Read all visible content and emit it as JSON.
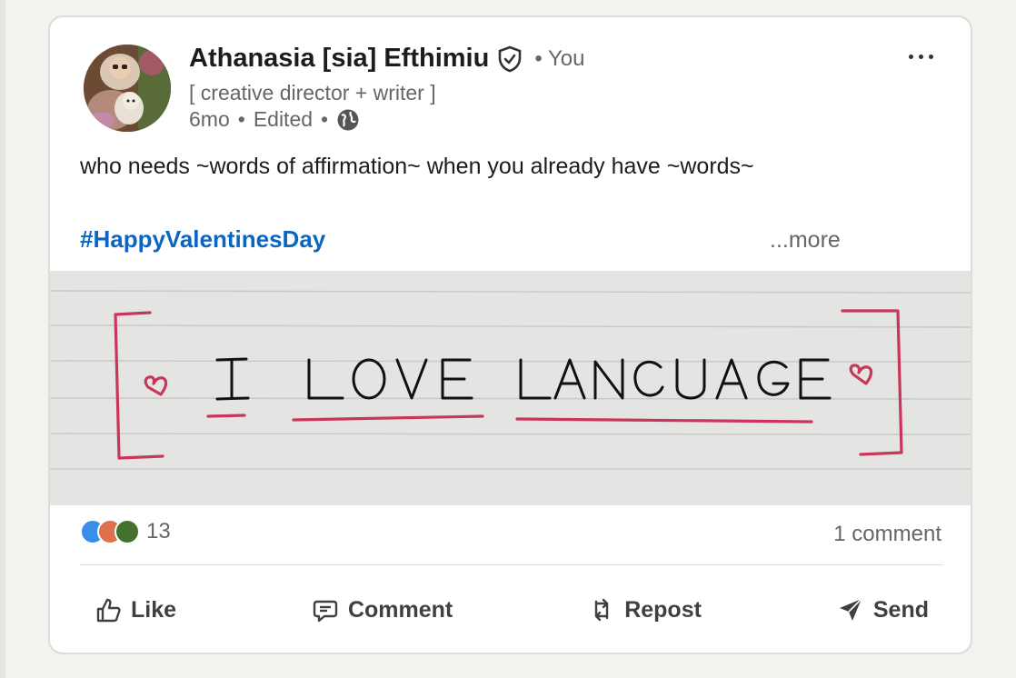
{
  "post": {
    "author": {
      "name": "Athanasia [sia] Efthimiu",
      "you_label": "• You",
      "headline": "[ creative director + writer ]",
      "time": "6mo",
      "edited": "Edited",
      "separator": "•"
    },
    "text": "who needs ~words of affirmation~ when you already have ~words~",
    "hashtag": "#HappyValentinesDay",
    "see_more": "...more",
    "image": {
      "handwritten_text": "I LOVE LANGUAGE",
      "words": [
        "I",
        "LOVE",
        "LANGUAGE"
      ],
      "ink_color": "#111111",
      "accent_color": "#c8375a",
      "paper_color": "#e4e4e2"
    },
    "social": {
      "reaction_icons": [
        "like-icon",
        "love-icon",
        "celebrate-icon"
      ],
      "reaction_count": "13",
      "comment_count": "1 comment"
    },
    "actions": [
      {
        "label": "Like",
        "icon": "thumbs-up-icon"
      },
      {
        "label": "Comment",
        "icon": "comment-bubble-icon"
      },
      {
        "label": "Repost",
        "icon": "repost-icon"
      },
      {
        "label": "Send",
        "icon": "send-icon"
      }
    ]
  },
  "colors": {
    "link": "#0a66c2",
    "secondary_text": "#666666",
    "card_bg": "#ffffff",
    "page_bg": "#f4f2ee"
  }
}
